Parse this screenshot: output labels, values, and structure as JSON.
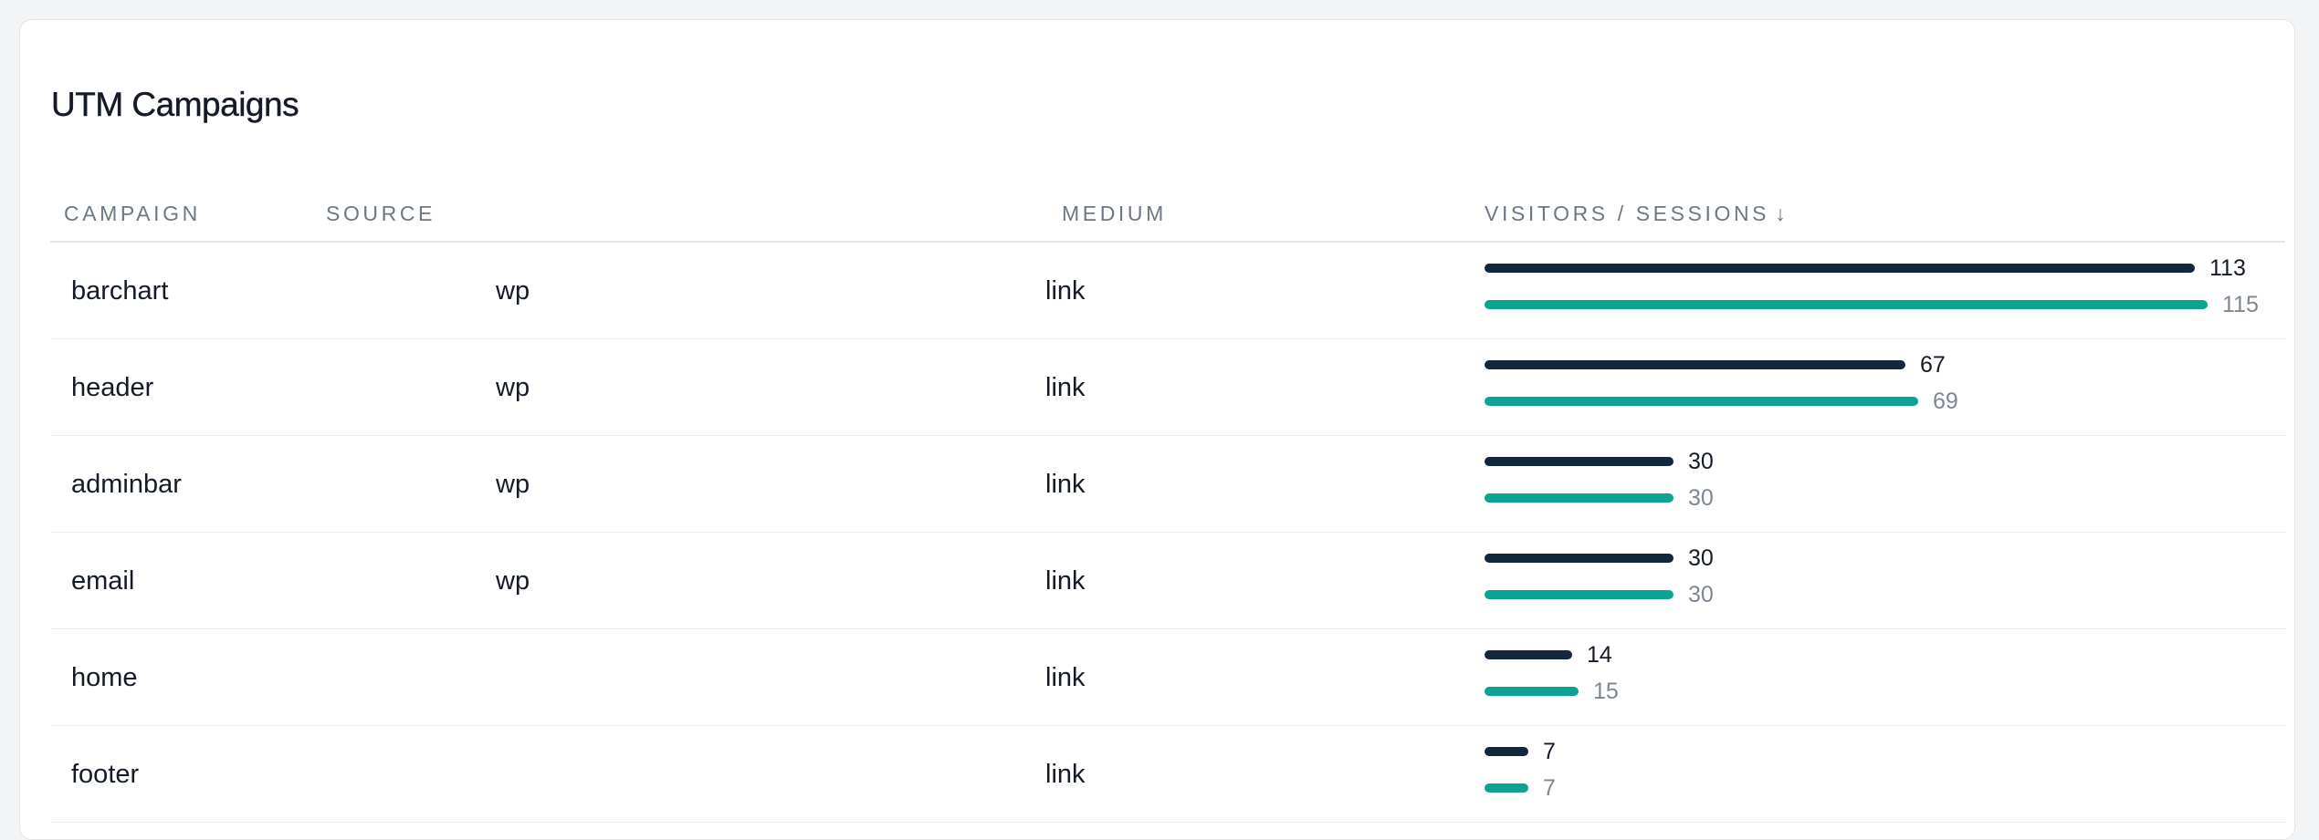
{
  "title": "UTM Campaigns",
  "columns": {
    "campaign": "CAMPAIGN",
    "source": "SOURCE",
    "medium": "MEDIUM",
    "metrics": "VISITORS / SESSIONS",
    "sort_indicator": "↓"
  },
  "colors": {
    "visitors": "#12263f",
    "sessions": "#0da393"
  },
  "rows": [
    {
      "campaign": "barchart",
      "source": "wp",
      "medium": "link",
      "visitors": "113",
      "sessions": "115"
    },
    {
      "campaign": "header",
      "source": "wp",
      "medium": "link",
      "visitors": "67",
      "sessions": "69"
    },
    {
      "campaign": "adminbar",
      "source": "wp",
      "medium": "link",
      "visitors": "30",
      "sessions": "30"
    },
    {
      "campaign": "email",
      "source": "wp",
      "medium": "link",
      "visitors": "30",
      "sessions": "30"
    },
    {
      "campaign": "home",
      "source": "",
      "medium": "link",
      "visitors": "14",
      "sessions": "15"
    },
    {
      "campaign": "footer",
      "source": "",
      "medium": "link",
      "visitors": "7",
      "sessions": "7"
    }
  ]
}
